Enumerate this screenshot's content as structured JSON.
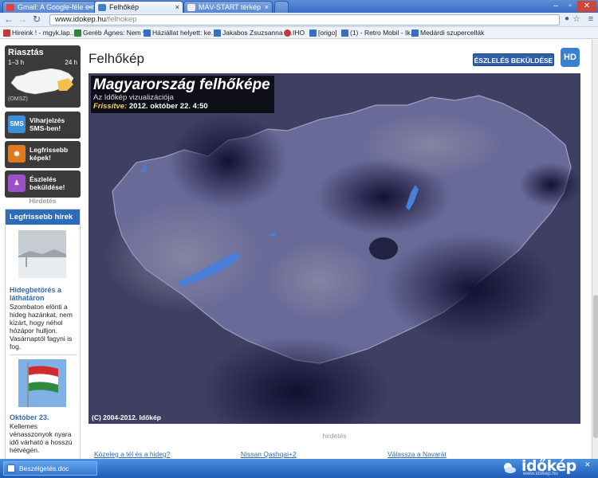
{
  "browser": {
    "tabs": [
      {
        "label": "Gmail: A Google-féle e-ma",
        "icon": "gmail-icon",
        "active": false
      },
      {
        "label": "Felhőkép",
        "icon": "page-icon",
        "active": true
      },
      {
        "label": "MÁV-START térkép",
        "icon": "page-icon",
        "active": false
      }
    ],
    "url_host": "www.idokep.hu",
    "url_path": "/felhokep",
    "bookmarks": [
      {
        "label": "Hireink ! - mgyk.lap...",
        "color": "#c03a3a"
      },
      {
        "label": "Geréb Ágnes: Nem v...",
        "color": "#2a8a3a"
      },
      {
        "label": "Háziállat helyett: ke...",
        "color": "#3a6cc0"
      },
      {
        "label": "Jakabos Zsuzsanna -...",
        "color": "#3a6cc0"
      },
      {
        "label": "IHO",
        "color": "#c03a3a"
      },
      {
        "label": "[origo]",
        "color": "#3a6cc0"
      },
      {
        "label": "(1) - Retro Mobil - Ik...",
        "color": "#3a6cc0"
      },
      {
        "label": "Medárdi szupercellák",
        "color": "#3a6cc0"
      }
    ]
  },
  "sidebar": {
    "alert": {
      "title": "Riasztás",
      "h1": "1–3 h",
      "h2": "24 h",
      "source": "(OMSZ)"
    },
    "buttons": [
      {
        "line1": "Viharjelzés",
        "line2": "SMS-ben!",
        "icon_text": "SMS",
        "icon_color": "#3a8fd8"
      },
      {
        "line1": "Legfrissebb",
        "line2": "képek!",
        "icon_text": "",
        "icon_color": "#e07a20"
      },
      {
        "line1": "Észlelés",
        "line2": "beküldése!",
        "icon_text": "",
        "icon_color": "#9b4fc8"
      }
    ],
    "ad_label": "Hirdetés",
    "news_header": "Legfrissebb hírek",
    "news": [
      {
        "title": "Hidegbetörés a láthatáron",
        "body": "Szombaton elönti a hideg hazánkat, nem kizárt, hogy néhol hózápor hulljon. Vasárnaptól fagyni is fog."
      },
      {
        "title": "Október 23.",
        "body": "Kellemes vénasszonyok nyara idő várható a hosszú hétvégén."
      }
    ]
  },
  "main": {
    "heading": "Felhőkép",
    "report_button": "ÉSZLELÉS BEKÜLDÉSE",
    "hd_button": "HD",
    "map": {
      "title": "Magyarország felhőképe",
      "subtitle": "Az Időkép vizualizációja",
      "updated_label": "Frissítve:",
      "updated_value": "2012. október 22. 4:50",
      "copyright": "(C) 2004-2012. Időkép"
    },
    "ad_label": "hirdetés",
    "bottom_links": [
      "Közeleg a tél és a hideg?",
      "Nissan Qashqai+2",
      "Válassza a Navarát"
    ]
  },
  "taskbar": {
    "item": "Beszélgetés.doc",
    "brand": "időkép",
    "brand_url": "www.idokep.hu"
  }
}
